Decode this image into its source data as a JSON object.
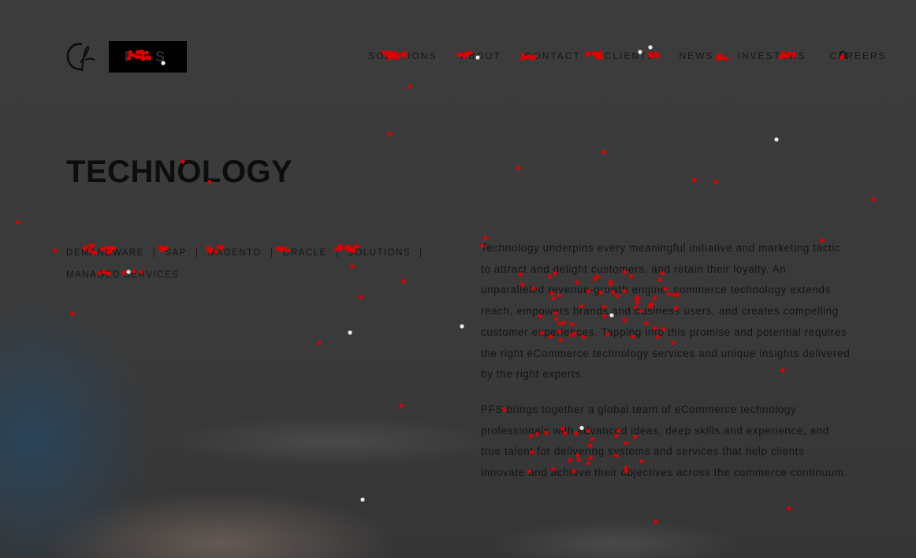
{
  "header": {
    "logo_text": "PFS",
    "nav": [
      {
        "label": "SOLUTIONS"
      },
      {
        "label": "ABOUT"
      },
      {
        "label": "CONTACT"
      },
      {
        "label": "CLIENTS"
      },
      {
        "label": "NEWS"
      },
      {
        "label": "INVESTORS"
      },
      {
        "label": "CAREERS"
      }
    ],
    "nav_icon": "search-icon"
  },
  "main": {
    "title": "TECHNOLOGY",
    "sublinks": [
      {
        "label": "DEMANDWARE"
      },
      {
        "label": "SAP"
      },
      {
        "label": "MAGENTO"
      },
      {
        "label": "ORACLE"
      },
      {
        "label": "SOLUTIONS"
      },
      {
        "label": "MANAGED SERVICES"
      }
    ],
    "separator": "|",
    "paragraphs": [
      "Technology underpins every meaningful initiative and marketing tactic to attract and delight customers, and retain their loyalty. An unparalleled revenue-growth engine, commerce technology extends reach, empowers brands and business users, and creates compelling customer experiences. Tapping into this promise and potential requires the right eCommerce technology services and unique insights delivered by the right experts.",
      "PFS brings together a global team of eCommerce technology professionals with advanced ideas, deep skills and experience, and true talent for delivering systems and services that help clients innovate and achieve their objectives across the commerce continuum."
    ]
  },
  "colors": {
    "overlay": "#3a3a3a",
    "gaze_dot": "#e00000",
    "gaze_dot_white": "#eeeeee",
    "text": "#141414"
  }
}
